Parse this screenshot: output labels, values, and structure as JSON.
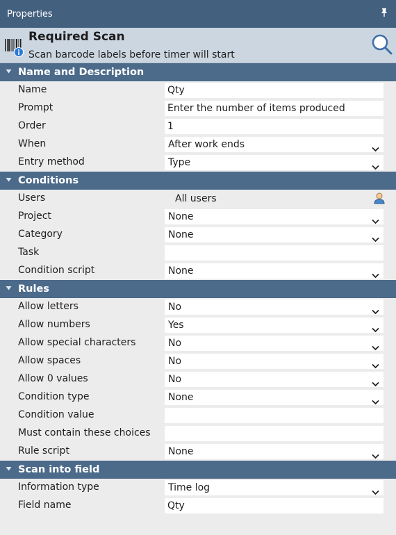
{
  "window": {
    "title": "Properties"
  },
  "header": {
    "title": "Required Scan",
    "subtitle": "Scan barcode labels before timer will start"
  },
  "sections": [
    {
      "title": "Name and Description",
      "rows": [
        {
          "label": "Name",
          "value": "Qty",
          "kind": "text"
        },
        {
          "label": "Prompt",
          "value": "Enter the number of items produced",
          "kind": "text"
        },
        {
          "label": "Order",
          "value": "1",
          "kind": "text"
        },
        {
          "label": "When",
          "value": "After work ends",
          "kind": "select"
        },
        {
          "label": "Entry method",
          "value": "Type",
          "kind": "select"
        }
      ]
    },
    {
      "title": "Conditions",
      "rows": [
        {
          "label": "Users",
          "value": "All users",
          "kind": "user"
        },
        {
          "label": "Project",
          "value": "None",
          "kind": "select"
        },
        {
          "label": "Category",
          "value": "None",
          "kind": "select"
        },
        {
          "label": "Task",
          "value": "",
          "kind": "text"
        },
        {
          "label": "Condition script",
          "value": "None",
          "kind": "select"
        }
      ]
    },
    {
      "title": "Rules",
      "rows": [
        {
          "label": "Allow letters",
          "value": "No",
          "kind": "select"
        },
        {
          "label": "Allow numbers",
          "value": "Yes",
          "kind": "select"
        },
        {
          "label": "Allow special characters",
          "value": "No",
          "kind": "select"
        },
        {
          "label": "Allow spaces",
          "value": "No",
          "kind": "select"
        },
        {
          "label": "Allow 0 values",
          "value": "No",
          "kind": "select"
        },
        {
          "label": "Condition type",
          "value": "None",
          "kind": "select"
        },
        {
          "label": "Condition value",
          "value": "",
          "kind": "text"
        },
        {
          "label": "Must contain these choices",
          "value": "",
          "kind": "text"
        },
        {
          "label": "Rule script",
          "value": "None",
          "kind": "select"
        }
      ]
    },
    {
      "title": "Scan into field",
      "rows": [
        {
          "label": "Information type",
          "value": "Time log",
          "kind": "select"
        },
        {
          "label": "Field name",
          "value": "Qty",
          "kind": "text"
        }
      ]
    }
  ],
  "icons": {
    "pin": "pin-icon",
    "barcode": "barcode-icon",
    "info": "info-icon",
    "search": "search-icon",
    "user": "user-icon",
    "chevron": "chevron-down-icon",
    "collapse": "collapse-triangle-icon"
  },
  "colors": {
    "titlebar": "#44607f",
    "header": "#ccd6e1",
    "section": "#4c6a8a",
    "field": "#ffffff"
  }
}
